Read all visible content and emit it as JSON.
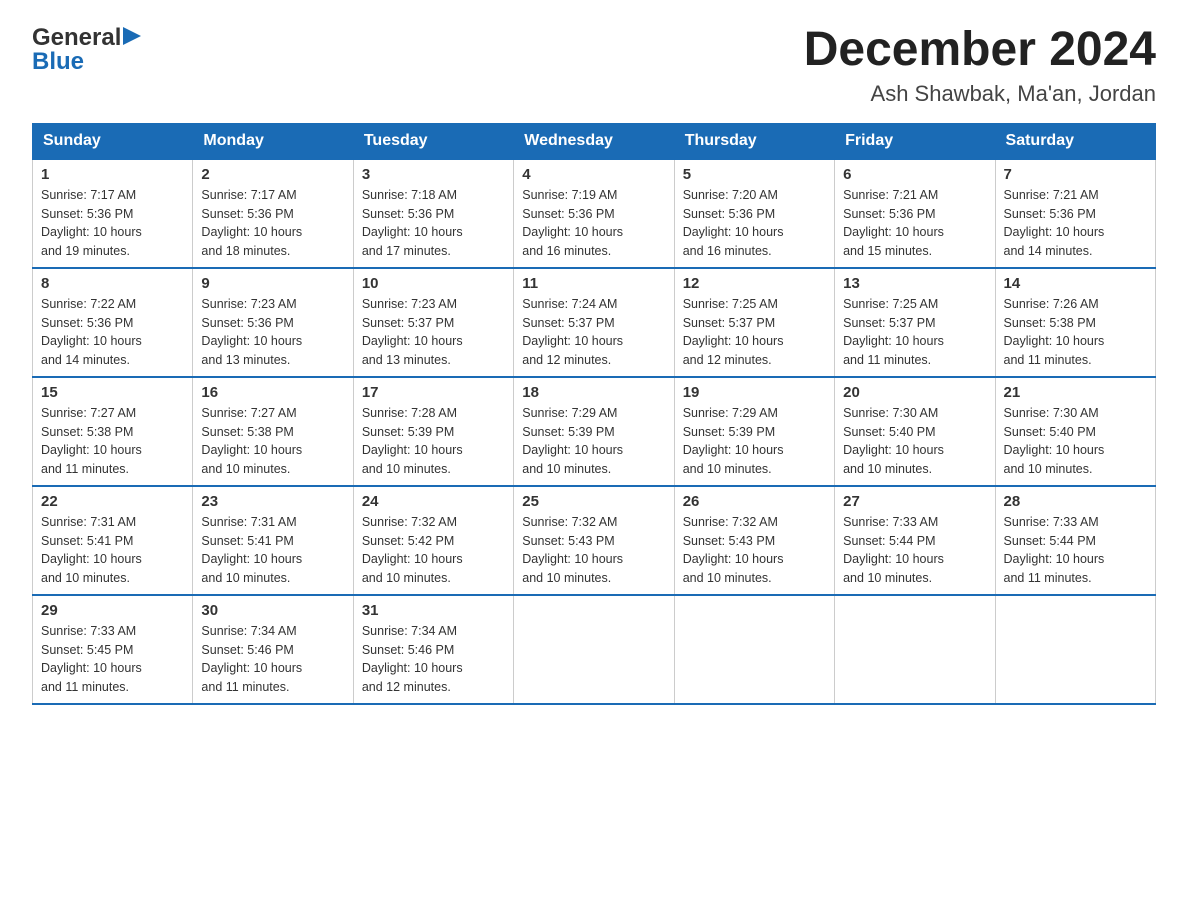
{
  "header": {
    "title": "December 2024",
    "subtitle": "Ash Shawbak, Ma'an, Jordan"
  },
  "logo": {
    "line1": "General",
    "line2": "Blue"
  },
  "days_of_week": [
    "Sunday",
    "Monday",
    "Tuesday",
    "Wednesday",
    "Thursday",
    "Friday",
    "Saturday"
  ],
  "weeks": [
    [
      {
        "day": "1",
        "sunrise": "7:17 AM",
        "sunset": "5:36 PM",
        "daylight": "10 hours and 19 minutes."
      },
      {
        "day": "2",
        "sunrise": "7:17 AM",
        "sunset": "5:36 PM",
        "daylight": "10 hours and 18 minutes."
      },
      {
        "day": "3",
        "sunrise": "7:18 AM",
        "sunset": "5:36 PM",
        "daylight": "10 hours and 17 minutes."
      },
      {
        "day": "4",
        "sunrise": "7:19 AM",
        "sunset": "5:36 PM",
        "daylight": "10 hours and 16 minutes."
      },
      {
        "day": "5",
        "sunrise": "7:20 AM",
        "sunset": "5:36 PM",
        "daylight": "10 hours and 16 minutes."
      },
      {
        "day": "6",
        "sunrise": "7:21 AM",
        "sunset": "5:36 PM",
        "daylight": "10 hours and 15 minutes."
      },
      {
        "day": "7",
        "sunrise": "7:21 AM",
        "sunset": "5:36 PM",
        "daylight": "10 hours and 14 minutes."
      }
    ],
    [
      {
        "day": "8",
        "sunrise": "7:22 AM",
        "sunset": "5:36 PM",
        "daylight": "10 hours and 14 minutes."
      },
      {
        "day": "9",
        "sunrise": "7:23 AM",
        "sunset": "5:36 PM",
        "daylight": "10 hours and 13 minutes."
      },
      {
        "day": "10",
        "sunrise": "7:23 AM",
        "sunset": "5:37 PM",
        "daylight": "10 hours and 13 minutes."
      },
      {
        "day": "11",
        "sunrise": "7:24 AM",
        "sunset": "5:37 PM",
        "daylight": "10 hours and 12 minutes."
      },
      {
        "day": "12",
        "sunrise": "7:25 AM",
        "sunset": "5:37 PM",
        "daylight": "10 hours and 12 minutes."
      },
      {
        "day": "13",
        "sunrise": "7:25 AM",
        "sunset": "5:37 PM",
        "daylight": "10 hours and 11 minutes."
      },
      {
        "day": "14",
        "sunrise": "7:26 AM",
        "sunset": "5:38 PM",
        "daylight": "10 hours and 11 minutes."
      }
    ],
    [
      {
        "day": "15",
        "sunrise": "7:27 AM",
        "sunset": "5:38 PM",
        "daylight": "10 hours and 11 minutes."
      },
      {
        "day": "16",
        "sunrise": "7:27 AM",
        "sunset": "5:38 PM",
        "daylight": "10 hours and 10 minutes."
      },
      {
        "day": "17",
        "sunrise": "7:28 AM",
        "sunset": "5:39 PM",
        "daylight": "10 hours and 10 minutes."
      },
      {
        "day": "18",
        "sunrise": "7:29 AM",
        "sunset": "5:39 PM",
        "daylight": "10 hours and 10 minutes."
      },
      {
        "day": "19",
        "sunrise": "7:29 AM",
        "sunset": "5:39 PM",
        "daylight": "10 hours and 10 minutes."
      },
      {
        "day": "20",
        "sunrise": "7:30 AM",
        "sunset": "5:40 PM",
        "daylight": "10 hours and 10 minutes."
      },
      {
        "day": "21",
        "sunrise": "7:30 AM",
        "sunset": "5:40 PM",
        "daylight": "10 hours and 10 minutes."
      }
    ],
    [
      {
        "day": "22",
        "sunrise": "7:31 AM",
        "sunset": "5:41 PM",
        "daylight": "10 hours and 10 minutes."
      },
      {
        "day": "23",
        "sunrise": "7:31 AM",
        "sunset": "5:41 PM",
        "daylight": "10 hours and 10 minutes."
      },
      {
        "day": "24",
        "sunrise": "7:32 AM",
        "sunset": "5:42 PM",
        "daylight": "10 hours and 10 minutes."
      },
      {
        "day": "25",
        "sunrise": "7:32 AM",
        "sunset": "5:43 PM",
        "daylight": "10 hours and 10 minutes."
      },
      {
        "day": "26",
        "sunrise": "7:32 AM",
        "sunset": "5:43 PM",
        "daylight": "10 hours and 10 minutes."
      },
      {
        "day": "27",
        "sunrise": "7:33 AM",
        "sunset": "5:44 PM",
        "daylight": "10 hours and 10 minutes."
      },
      {
        "day": "28",
        "sunrise": "7:33 AM",
        "sunset": "5:44 PM",
        "daylight": "10 hours and 11 minutes."
      }
    ],
    [
      {
        "day": "29",
        "sunrise": "7:33 AM",
        "sunset": "5:45 PM",
        "daylight": "10 hours and 11 minutes."
      },
      {
        "day": "30",
        "sunrise": "7:34 AM",
        "sunset": "5:46 PM",
        "daylight": "10 hours and 11 minutes."
      },
      {
        "day": "31",
        "sunrise": "7:34 AM",
        "sunset": "5:46 PM",
        "daylight": "10 hours and 12 minutes."
      },
      null,
      null,
      null,
      null
    ]
  ],
  "labels": {
    "sunrise": "Sunrise:",
    "sunset": "Sunset:",
    "daylight": "Daylight:"
  }
}
